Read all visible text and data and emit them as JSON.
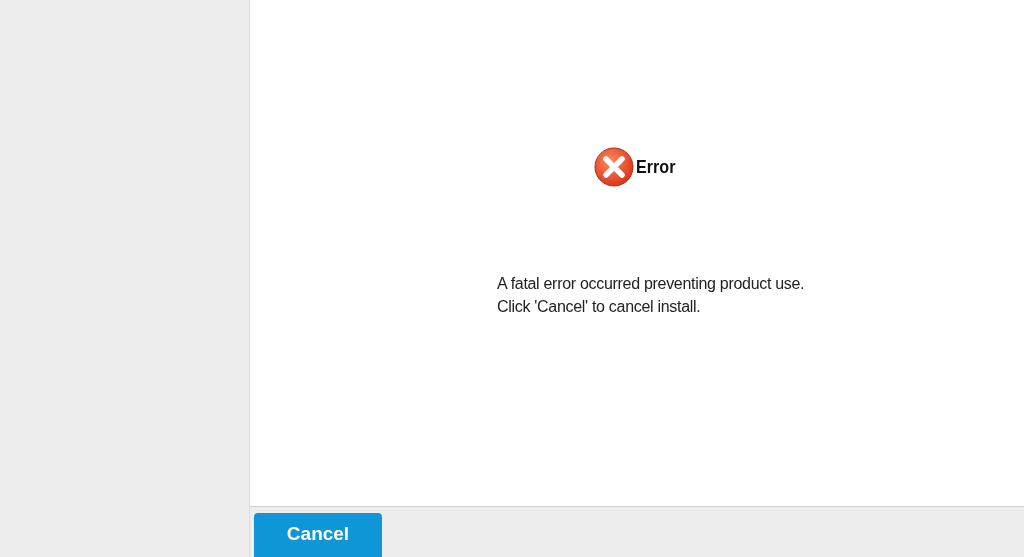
{
  "dialog": {
    "title": "Error",
    "message_lines": [
      "A fatal error occurred preventing product use.",
      "Click 'Cancel' to cancel install."
    ]
  },
  "buttons": [
    {
      "label": "Cancel",
      "kind": "primary"
    }
  ]
}
